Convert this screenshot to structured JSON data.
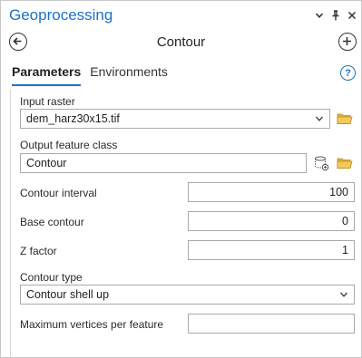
{
  "pane": {
    "title": "Geoprocessing",
    "controls": {
      "menu": "chevron-down-icon",
      "pin": "pin-icon",
      "close": "close-icon"
    }
  },
  "tool": {
    "title": "Contour",
    "back_icon": "back-arrow-icon",
    "add_icon": "add-icon"
  },
  "tabs": [
    {
      "label": "Parameters",
      "active": true
    },
    {
      "label": "Environments",
      "active": false
    }
  ],
  "help_label": "?",
  "params": {
    "input_raster": {
      "label": "Input raster",
      "value": "dem_harz30x15.tif"
    },
    "output_feature_class": {
      "label": "Output feature class",
      "value": "Contour"
    },
    "contour_interval": {
      "label": "Contour interval",
      "value": "100"
    },
    "base_contour": {
      "label": "Base contour",
      "value": "0"
    },
    "z_factor": {
      "label": "Z factor",
      "value": "1"
    },
    "contour_type": {
      "label": "Contour type",
      "value": "Contour shell up"
    },
    "max_vertices": {
      "label": "Maximum vertices per feature",
      "value": ""
    }
  },
  "colors": {
    "accent": "#1a72c8",
    "folder": "#e3b33b",
    "border": "#a9a9a9"
  }
}
